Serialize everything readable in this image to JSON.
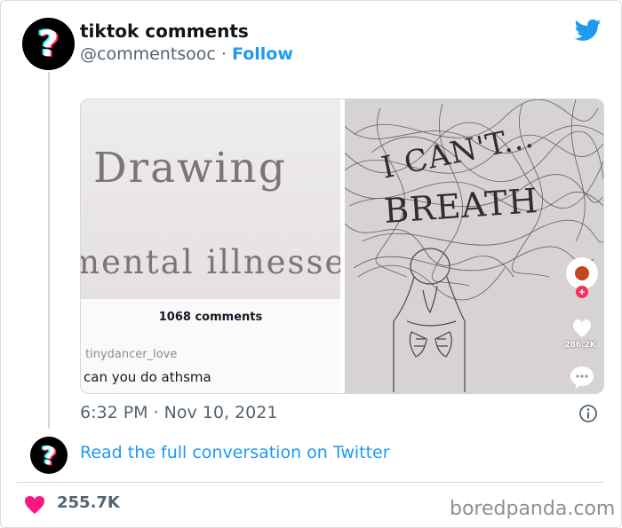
{
  "tweet": {
    "author_name": "tiktok comments",
    "handle": "@commentsooc",
    "separator": "·",
    "follow_label": "Follow",
    "avatar_glyph": "?",
    "timestamp": "6:32 PM · Nov 10, 2021",
    "read_conversation": "Read the full conversation on Twitter",
    "likes": "255.7K"
  },
  "media": {
    "left_image": {
      "line1": "Drawing",
      "line2": "mental illnesses",
      "comments_count": "1068 comments",
      "commenter": "tinydancer_love",
      "comment": "can you do athsma"
    },
    "right_image": {
      "line1": "I CAN'T...",
      "line2": "BREATH",
      "like_count": "286.2K"
    }
  },
  "watermark": "boredpanda.com",
  "colors": {
    "twitter_blue": "#1d9bf0",
    "heart_red": "#f91880",
    "text_gray": "#536471",
    "tiktok_cyan": "#25f4ee",
    "tiktok_red": "#fe2c55"
  },
  "icons": [
    "twitter-bird-icon",
    "info-icon",
    "heart-icon",
    "tiktok-like-icon",
    "tiktok-comment-icon"
  ]
}
